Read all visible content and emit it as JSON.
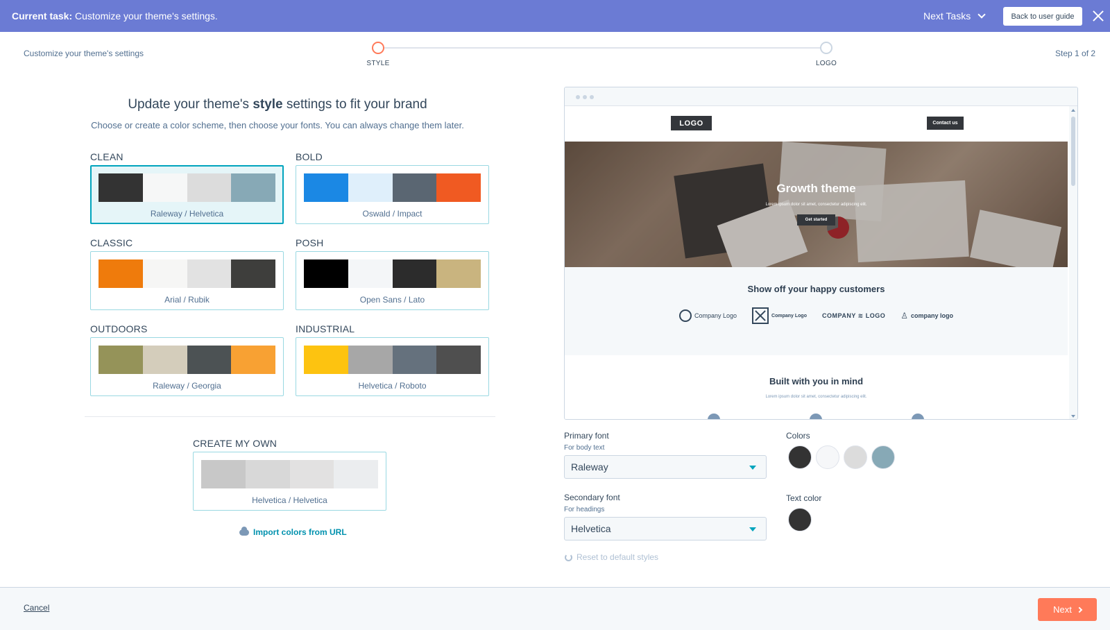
{
  "banner": {
    "task_label": "Current task:",
    "task_text": "Customize your theme's settings.",
    "next_tasks": "Next Tasks",
    "back_button": "Back to user guide"
  },
  "header": {
    "breadcrumb": "Customize your theme's settings",
    "step_count": "Step 1 of 2",
    "steps": [
      {
        "label": "STYLE",
        "active": true
      },
      {
        "label": "LOGO",
        "active": false
      }
    ]
  },
  "main": {
    "heading_pre": "Update your theme's ",
    "heading_bold": "style",
    "heading_post": " settings to fit your brand",
    "subheading": "Choose or create a color scheme, then choose your fonts. You can always change them later.",
    "schemes": [
      {
        "name": "CLEAN",
        "fonts": "Raleway / Helvetica",
        "colors": [
          "#333333",
          "#f6f7f7",
          "#dcdcdc",
          "#87a9b6"
        ],
        "selected": true
      },
      {
        "name": "BOLD",
        "fonts": "Oswald / Impact",
        "colors": [
          "#1b88e4",
          "#dfeffb",
          "#5a6672",
          "#f05a22"
        ],
        "selected": false
      },
      {
        "name": "CLASSIC",
        "fonts": "Arial / Rubik",
        "colors": [
          "#ef7b0c",
          "#f6f6f5",
          "#e2e2e2",
          "#3e3e3c"
        ],
        "selected": false
      },
      {
        "name": "POSH",
        "fonts": "Open Sans / Lato",
        "colors": [
          "#000000",
          "#f4f6f8",
          "#2c2c2c",
          "#c9b47f"
        ],
        "selected": false
      },
      {
        "name": "OUTDOORS",
        "fonts": "Raleway / Georgia",
        "colors": [
          "#959359",
          "#d4cdbb",
          "#4c5254",
          "#f8a133"
        ],
        "selected": false
      },
      {
        "name": "INDUSTRIAL",
        "fonts": "Helvetica / Roboto",
        "colors": [
          "#fdc310",
          "#a7a7a7",
          "#65717d",
          "#4f4f4f"
        ],
        "selected": false
      }
    ],
    "create_own": {
      "name": "CREATE MY OWN",
      "fonts": "Helvetica / Helvetica",
      "colors": [
        "#c8c8c8",
        "#d8d8d8",
        "#e2e1e1",
        "#ebedef"
      ]
    },
    "import_link": "Import colors from URL"
  },
  "preview": {
    "logo": "LOGO",
    "contact": "Contact us",
    "hero_title": "Growth theme",
    "hero_sub": "Lorem ipsum dolor sit amet, consectetur adipiscing elit.",
    "hero_cta": "Get started",
    "customers_heading": "Show off your happy customers",
    "customer_logos": [
      "Company Logo",
      "Company Logo",
      "COMPANY ≋ LOGO",
      "company logo"
    ],
    "built_heading": "Built with you in mind",
    "built_sub": "Lorem ipsum dolor sit amet, consectetur adipiscing elit."
  },
  "fonts": {
    "primary_label": "Primary font",
    "primary_sub": "For body text",
    "primary_value": "Raleway",
    "secondary_label": "Secondary font",
    "secondary_sub": "For headings",
    "secondary_value": "Helvetica",
    "reset": "Reset to default styles"
  },
  "colors": {
    "label": "Colors",
    "values": [
      "#333333",
      "#f6f7f9",
      "#dcdcdc",
      "#87a9b6"
    ],
    "text_label": "Text color",
    "text_value": "#333333"
  },
  "footer": {
    "cancel": "Cancel",
    "next": "Next"
  }
}
